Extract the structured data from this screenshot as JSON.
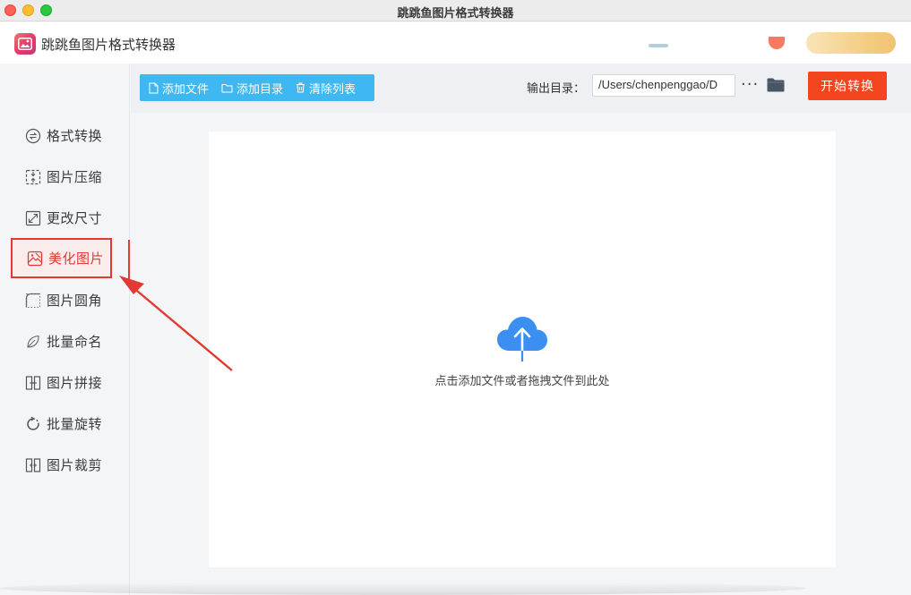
{
  "window": {
    "title": "跳跳鱼图片格式转换器"
  },
  "app": {
    "name": "跳跳鱼图片格式转换器"
  },
  "sidebar": {
    "items": [
      {
        "label": "格式转换",
        "icon": "swap-circle-icon",
        "active": false
      },
      {
        "label": "图片压缩",
        "icon": "compress-icon",
        "active": false
      },
      {
        "label": "更改尺寸",
        "icon": "resize-icon",
        "active": false
      },
      {
        "label": "美化图片",
        "icon": "beautify-image-icon",
        "active": true
      },
      {
        "label": "图片圆角",
        "icon": "rounded-corner-icon",
        "active": false
      },
      {
        "label": "批量命名",
        "icon": "rename-leaf-icon",
        "active": false
      },
      {
        "label": "图片拼接",
        "icon": "stitch-icon",
        "active": false
      },
      {
        "label": "批量旋转",
        "icon": "rotate-icon",
        "active": false
      },
      {
        "label": "图片裁剪",
        "icon": "crop-icon",
        "active": false
      }
    ]
  },
  "toolbar": {
    "add_file": "添加文件",
    "add_folder": "添加目录",
    "clear_list": "清除列表",
    "output_label": "输出目录：",
    "output_path": "/Users/chenpenggao/D",
    "more": "···",
    "start": "开始转换"
  },
  "dropzone": {
    "hint": "点击添加文件或者拖拽文件到此处"
  },
  "colors": {
    "accent_blue": "#3fb8f2",
    "start_red": "#f3461e",
    "annotation_red": "#e23a32",
    "cloud_blue": "#3b8ff0"
  }
}
